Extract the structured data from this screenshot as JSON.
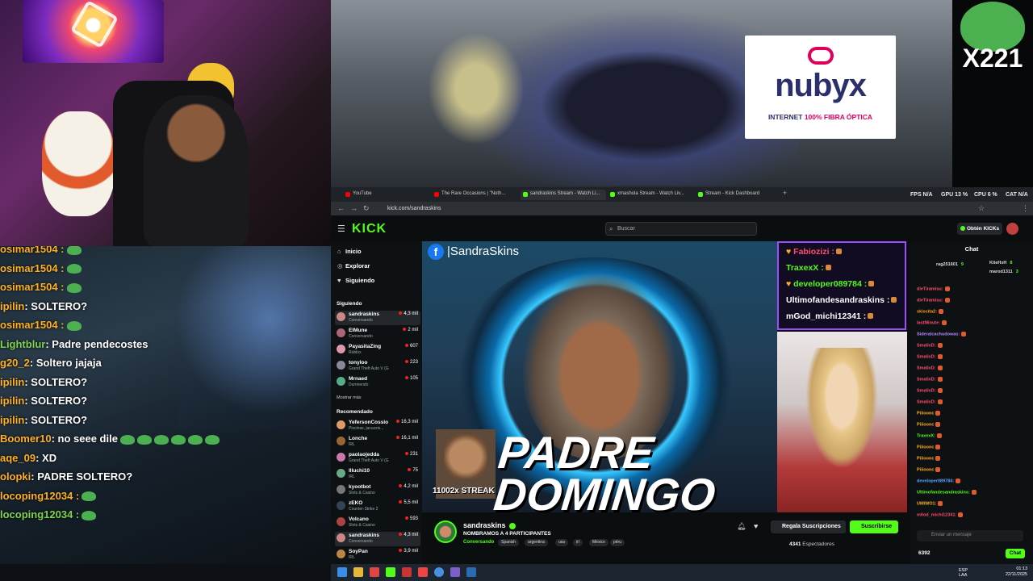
{
  "left_chat": [
    {
      "user": "osimar1504 :",
      "msg": "",
      "emote": true,
      "color": "orange"
    },
    {
      "user": "osimar1504 :",
      "msg": "",
      "emote": true,
      "color": "orange"
    },
    {
      "user": "osimar1504 :",
      "msg": "",
      "emote": true,
      "color": "orange"
    },
    {
      "user": "ipilin",
      "msg": ": SOLTERO?",
      "emote": false,
      "color": "orange"
    },
    {
      "user": "osimar1504 :",
      "msg": "",
      "emote": true,
      "color": "orange"
    },
    {
      "user": "Lightblur",
      "msg": ": Padre pendecostes",
      "emote": false,
      "color": "green"
    },
    {
      "user": "g20_2",
      "msg": ": Soltero jajaja",
      "emote": false,
      "color": "orange"
    },
    {
      "user": "ipilin",
      "msg": ": SOLTERO?",
      "emote": false,
      "color": "orange"
    },
    {
      "user": "ipilin",
      "msg": ": SOLTERO?",
      "emote": false,
      "color": "orange"
    },
    {
      "user": "ipilin",
      "msg": ": SOLTERO?",
      "emote": false,
      "color": "orange"
    },
    {
      "user": "Boomer10",
      "msg": ": no seee dile",
      "emote": true,
      "color": "orange"
    },
    {
      "user": "aqe_09",
      "msg": ": XD",
      "emote": false,
      "color": "orange"
    },
    {
      "user": "olopki",
      "msg": ": PADRE SOLTERO?",
      "emote": false,
      "color": "orange"
    },
    {
      "user": "locoping12034 :",
      "msg": "",
      "emote": true,
      "color": "orange"
    },
    {
      "user": "locoping12034 :",
      "msg": "",
      "emote": true,
      "color": "green"
    }
  ],
  "sponsor": {
    "brand": "nubyx",
    "tag_pre": "INTERNET ",
    "tag_hl": "100% FIBRA ÓPTICA"
  },
  "corner_badge": "X221",
  "browser": {
    "tabs": [
      {
        "label": "YouTube",
        "color": "#ff0000"
      },
      {
        "label": "The Rare Occasions | \"Noth...",
        "color": "#ff0000"
      },
      {
        "label": "sandraskins Stream - Watch Li...",
        "color": "#53fc18"
      },
      {
        "label": "xmashola Stream - Watch Liv...",
        "color": "#53fc18"
      },
      {
        "label": "Stream - Kick Dashboard",
        "color": "#53fc18"
      }
    ],
    "url": "kick.com/sandraskins",
    "hud": {
      "fps": "FPS  N/A",
      "gpu": "GPU  13 %",
      "cpu": "CPU  6 %",
      "cat": "CAT  N/A"
    }
  },
  "kick": {
    "logo": "KICK",
    "search_placeholder": "Buscar",
    "get_kicks": "Obtén KICKs",
    "nav": [
      {
        "label": "Inicio",
        "icon": "⌂"
      },
      {
        "label": "Explorar",
        "icon": "◎"
      },
      {
        "label": "Siguiendo",
        "icon": "♥"
      }
    ],
    "following_title": "Siguiendo",
    "following": [
      {
        "name": "sandraskins",
        "cat": "Conversando",
        "viewers": "4,3 mil",
        "active": true,
        "color": "#c88"
      },
      {
        "name": "ElMune",
        "cat": "Conversando",
        "viewers": "2 mil",
        "color": "#a67"
      },
      {
        "name": "PayasitaZing",
        "cat": "Roblox",
        "viewers": "607",
        "color": "#d9a"
      },
      {
        "name": "tonyloo",
        "cat": "Grand Theft Auto V (G...",
        "viewers": "223",
        "color": "#889"
      },
      {
        "name": "Mrnaed",
        "cat": "Durmiendo",
        "viewers": "105",
        "color": "#5a8"
      }
    ],
    "show_more": "Mostrar más",
    "recommended_title": "Recomendado",
    "recommended": [
      {
        "name": "YefersonCossio",
        "cat": "Piscinas, jacuzzis...",
        "viewers": "16,3 mil",
        "color": "#d96"
      },
      {
        "name": "Lonche",
        "cat": "IRL",
        "viewers": "16,1 mil",
        "color": "#963"
      },
      {
        "name": "paolaojedda",
        "cat": "Grand Theft Auto V (G...",
        "viewers": "231",
        "color": "#c7a"
      },
      {
        "name": "Illuchi10",
        "cat": "IRL",
        "viewers": "75",
        "color": "#6a8"
      },
      {
        "name": "kyootbot",
        "cat": "Slots & Casino",
        "viewers": "4,2 mil",
        "color": "#777"
      },
      {
        "name": "zEKO",
        "cat": "Counter-Strike 2",
        "viewers": "5,5 mil",
        "color": "#345"
      },
      {
        "name": "Volcano",
        "cat": "Slots & Casino",
        "viewers": "593",
        "color": "#a44"
      },
      {
        "name": "sandraskins",
        "cat": "Conversando",
        "viewers": "4,3 mil",
        "active": true,
        "color": "#c88"
      },
      {
        "name": "SoyPan",
        "cat": "IRL",
        "viewers": "3,9 mil",
        "color": "#b84"
      }
    ]
  },
  "stream": {
    "fb_handle": "|SandraSkins",
    "headline_1": "PADRE",
    "headline_2": "DOMINGO",
    "streak": "11002x STREAK"
  },
  "overlay_chat": [
    {
      "user": "Fabiozizi :",
      "color": "#ff4d6d",
      "badge": true
    },
    {
      "user": "TraxexX :",
      "color": "#53fc18",
      "badge": false
    },
    {
      "user": "developer089784 :",
      "color": "#53fc18",
      "badge": true
    },
    {
      "user": "Ultimofandesandraskins :",
      "color": "#ffffff",
      "badge": false
    },
    {
      "user": "mGod_michi12341 :",
      "color": "#ffffff",
      "badge": false
    }
  ],
  "right_chat": {
    "title": "Chat",
    "pinned": [
      {
        "user": "rag251601",
        "viewers": "9"
      },
      {
        "user": "KiteHxH",
        "viewers": "8"
      },
      {
        "user": "marod1311",
        "viewers": "3"
      }
    ],
    "lines": [
      {
        "user": "dieTiramisu:",
        "color": "#ff4d6d"
      },
      {
        "user": "dieTiramisu:",
        "color": "#ff4d6d"
      },
      {
        "user": "skiscita2:",
        "color": "#ff9f1a"
      },
      {
        "user": "lastMinute:",
        "color": "#ff4d6d"
      },
      {
        "user": "Sideralcachudowas:",
        "color": "#b388ff"
      },
      {
        "user": "SmalixD:",
        "color": "#ff4d6d"
      },
      {
        "user": "SmalixD:",
        "color": "#ff4d6d"
      },
      {
        "user": "SmalixD:",
        "color": "#ff4d6d"
      },
      {
        "user": "SmalixD:",
        "color": "#ff4d6d"
      },
      {
        "user": "SmalixD:",
        "color": "#ff4d6d"
      },
      {
        "user": "SmalixD:",
        "color": "#ff4d6d"
      },
      {
        "user": "Piiioonc",
        "color": "#ffb020"
      },
      {
        "user": "Piiioonc",
        "color": "#ffb020"
      },
      {
        "user": "TraxexX:",
        "color": "#53fc18"
      },
      {
        "user": "Piiioonc",
        "color": "#ffb020"
      },
      {
        "user": "Piiioonc",
        "color": "#ffb020"
      },
      {
        "user": "Piiioonc",
        "color": "#ffb020"
      },
      {
        "user": "developer089784:",
        "color": "#53a8ff"
      },
      {
        "user": "Ultimofandesandraskins:",
        "color": "#53fc18"
      },
      {
        "user": "UMIWO1:",
        "color": "#ffb020"
      },
      {
        "user": "m0od_michi12341:",
        "color": "#ff4d6d"
      }
    ],
    "input_placeholder": "Enviar un mensaje",
    "kicks": "6392",
    "chat_button": "Chat"
  },
  "stream_info": {
    "name": "sandraskins",
    "title": "NOMBRAMOS A 4 PARTICIPANTES",
    "category": "Conversando",
    "tags": [
      "Spanish",
      "argentina",
      "usa",
      "irl",
      "México",
      "péru"
    ],
    "gift_button": "Regala Suscripciones",
    "sub_button": "Suscribirse",
    "viewers_count": "4341",
    "viewers_label": "Espectadores"
  },
  "taskbar": {
    "time": "01:13",
    "date": "22/11/2025",
    "lang": "ESP",
    "region": "LAA"
  }
}
